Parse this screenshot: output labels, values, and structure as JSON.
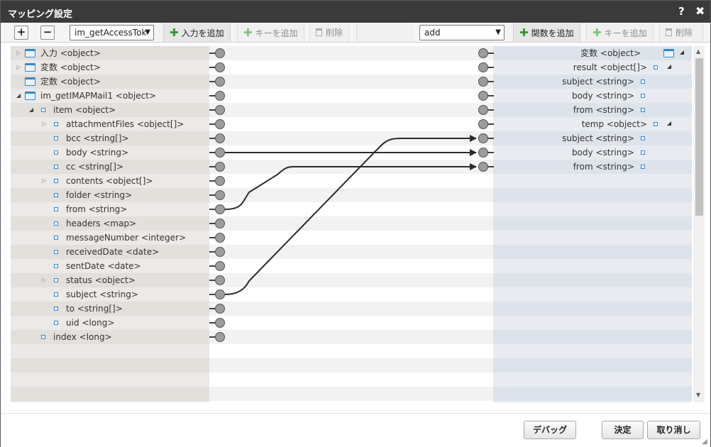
{
  "window": {
    "title": "マッピング設定",
    "help_label": "?",
    "close_label": "✖"
  },
  "toolbar": {
    "expand_all": "+",
    "collapse_all": "−",
    "input_select_value": "im_getAccessTok",
    "add_input": "入力を追加",
    "add_key_left": "キーを追加",
    "delete_left": "削除",
    "function_select_value": "add",
    "add_function": "関数を追加",
    "add_key_right": "キーを追加",
    "delete_right": "削除"
  },
  "left_tree": [
    {
      "label": "入力 <object>"
    },
    {
      "label": "変数 <object>"
    },
    {
      "label": "定数 <object>"
    },
    {
      "label": "im_getIMAPMail1 <object>"
    },
    {
      "label": "item <object>"
    },
    {
      "label": "attachmentFiles <object[]>"
    },
    {
      "label": "bcc <string[]>"
    },
    {
      "label": "body <string>"
    },
    {
      "label": "cc <string[]>"
    },
    {
      "label": "contents <object[]>"
    },
    {
      "label": "folder <string>"
    },
    {
      "label": "from <string>"
    },
    {
      "label": "headers <map>"
    },
    {
      "label": "messageNumber <integer>"
    },
    {
      "label": "receivedDate <date>"
    },
    {
      "label": "sentDate <date>"
    },
    {
      "label": "status <object>"
    },
    {
      "label": "subject <string>"
    },
    {
      "label": "to <string[]>"
    },
    {
      "label": "uid <long>"
    },
    {
      "label": "index <long>"
    }
  ],
  "right_tree": [
    {
      "label": "変数 <object>"
    },
    {
      "label": "result <object[]>"
    },
    {
      "label": "subject <string>"
    },
    {
      "label": "body <string>"
    },
    {
      "label": "from <string>"
    },
    {
      "label": "temp <object>"
    },
    {
      "label": "subject <string>"
    },
    {
      "label": "body <string>"
    },
    {
      "label": "from <string>"
    }
  ],
  "mappings": [
    {
      "from": "body <string>",
      "to": "temp.body <string>"
    },
    {
      "from": "from <string>",
      "to": "temp.from <string>"
    },
    {
      "from": "subject <string>",
      "to": "temp.subject <string>"
    }
  ],
  "footer": {
    "debug": "デバッグ",
    "ok": "決定",
    "cancel": "取り消し"
  }
}
